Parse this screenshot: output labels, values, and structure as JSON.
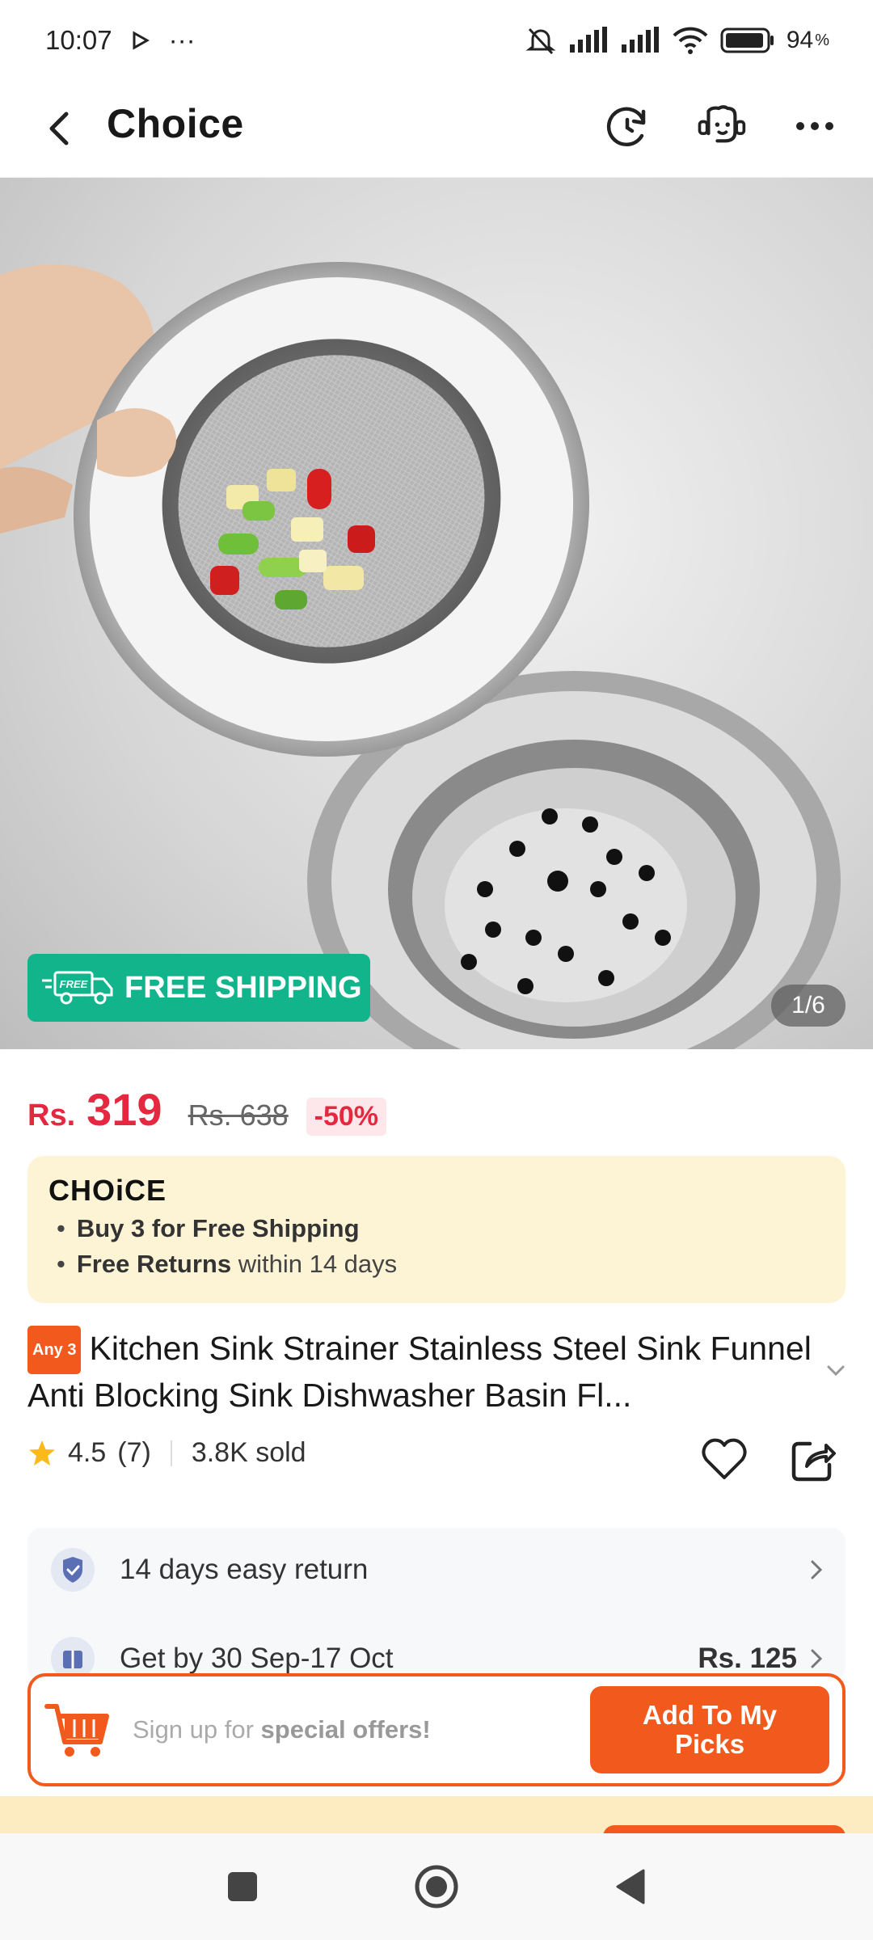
{
  "status_bar": {
    "time": "10:07",
    "more": "···",
    "battery": "94",
    "battery_unit": "%"
  },
  "header": {
    "title": "Choice"
  },
  "hero": {
    "badge_label": "FREE SHIPPING",
    "badge_icon_text": "FREE",
    "pager": "1/6"
  },
  "price": {
    "currency": "Rs.",
    "current": "319",
    "original": "Rs. 638",
    "discount": "-50%"
  },
  "choice": {
    "logo": "CHOiCE",
    "line1_bold": "Buy 3 for  Free Shipping",
    "line2_bold": "Free Returns",
    "line2_rest": "within 14 days"
  },
  "product": {
    "tag": "Any 3",
    "title": "Kitchen Sink Strainer Stainless Steel Sink Funnel Anti Blocking Sink Dishwasher Basin Fl...",
    "rating": "4.5",
    "reviews": "(7)",
    "sold": "3.8K sold"
  },
  "services": {
    "return_text": "14 days easy return",
    "delivery_text": "Get by 30 Sep-17 Oct",
    "delivery_price": "Rs. 125"
  },
  "signup": {
    "text_pre": "Sign up for ",
    "text_bold": "special offers!",
    "button_line1": "Add To My",
    "button_line2": "Picks"
  },
  "colors": {
    "accent": "#f25a1d",
    "price": "#e5283f",
    "free_shipping": "#12b48c"
  }
}
